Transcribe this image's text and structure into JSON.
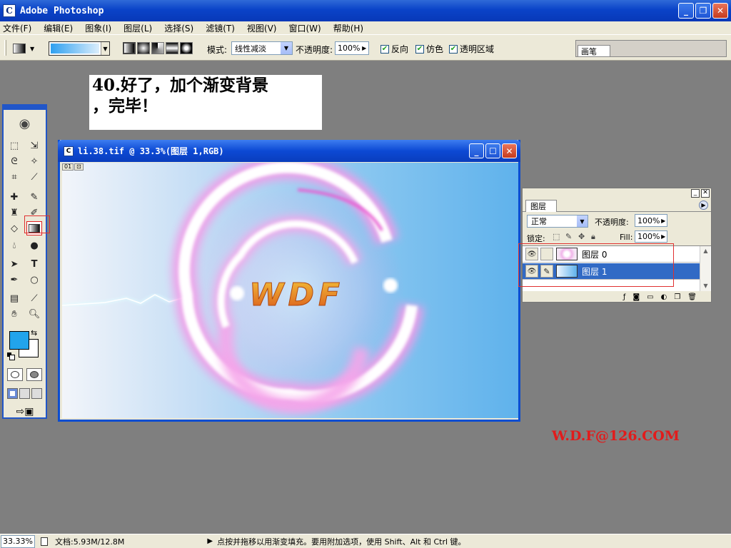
{
  "app": {
    "title": "Adobe Photoshop"
  },
  "menu": [
    "文件(F)",
    "编辑(E)",
    "图象(I)",
    "图层(L)",
    "选择(S)",
    "滤镜(T)",
    "视图(V)",
    "窗口(W)",
    "帮助(H)"
  ],
  "options": {
    "mode_label": "模式:",
    "mode_value": "线性减淡",
    "opacity_label": "不透明度:",
    "opacity_value": "100%",
    "reverse_label": "反向",
    "dither_label": "仿色",
    "transparency_label": "透明区域",
    "brushes_tab": "画笔"
  },
  "caption": {
    "line1": "40.好了，加个渐变背景",
    "line2": "，完毕！"
  },
  "document": {
    "title": "li.38.tif @ 33.3%(图层 1,RGB)",
    "artwork_text": "WDF",
    "chip1": "01",
    "chip2": "⊡"
  },
  "layers_panel": {
    "tab": "图层",
    "blend_mode": "正常",
    "opacity_label": "不透明度:",
    "opacity_value": "100%",
    "lock_label": "锁定:",
    "fill_label": "Fill:",
    "fill_value": "100%",
    "layers": [
      {
        "name": "图层 0",
        "selected": false
      },
      {
        "name": "图层 1",
        "selected": true
      }
    ]
  },
  "toolbox": {
    "foreground_color": "#22a4ec",
    "background_color": "#ffffff"
  },
  "watermark": "W.D.F@126.COM",
  "status": {
    "zoom": "33.33%",
    "doc_info": "文档:5.93M/12.8M",
    "message": "点按并拖移以用渐变填充。要用附加选项，使用 Shift、Alt 和 Ctrl 键。"
  }
}
